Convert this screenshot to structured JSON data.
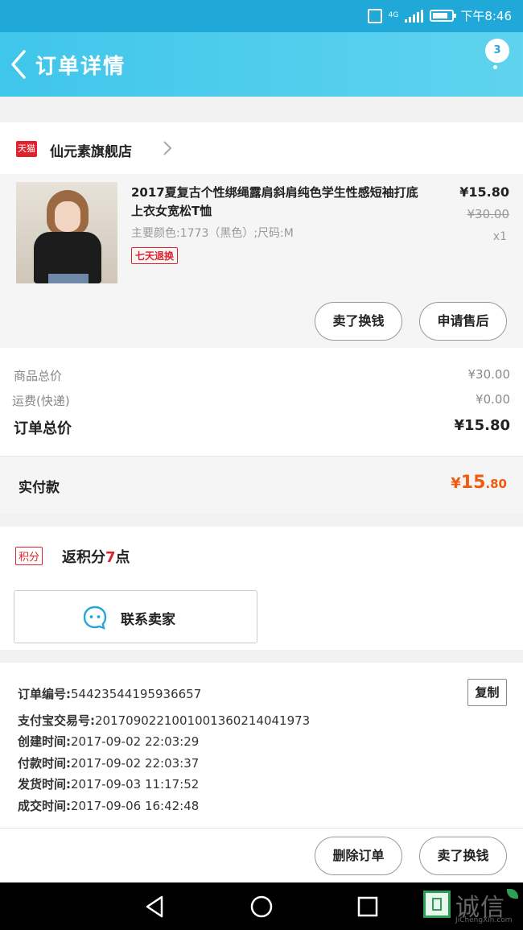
{
  "status_bar": {
    "network": "4G",
    "time": "下午8:46"
  },
  "header": {
    "title": "订单详情",
    "badge_count": "3"
  },
  "shop": {
    "tmall_label": "天猫",
    "name": "仙元素旗舰店"
  },
  "product": {
    "title": "2017夏复古个性绑绳露肩斜肩纯色学生性感短袖打底上衣女宽松T恤",
    "spec": "主要颜色:1773（黑色）;尺码:M",
    "tag": "七天退换",
    "price": "¥15.80",
    "original_price": "¥30.00",
    "quantity": "x1",
    "buttons": {
      "sell_back": "卖了换钱",
      "after_sale": "申请售后"
    }
  },
  "summary": {
    "goods_total_label": "商品总价",
    "goods_total_value": "¥30.00",
    "shipping_label": "运费(快递)",
    "shipping_value": "¥0.00",
    "order_total_label": "订单总价",
    "order_total_value": "¥15.80"
  },
  "payment": {
    "label": "实付款",
    "currency": "¥",
    "amount_int": "15",
    "amount_dec": ".80"
  },
  "points": {
    "tag": "积分",
    "prefix": "返积分",
    "count": "7",
    "suffix": "点",
    "contact_label": "联系卖家"
  },
  "order_info": {
    "order_no_label": "订单编号:",
    "order_no": "54423544195936657",
    "alipay_label": "支付宝交易号:",
    "alipay_no": "2017090221001001360214041973",
    "created_label": "创建时间:",
    "created": "2017-09-02 22:03:29",
    "paid_label": "付款时间:",
    "paid": "2017-09-02 22:03:37",
    "shipped_label": "发货时间:",
    "shipped": "2017-09-03 11:17:52",
    "completed_label": "成交时间:",
    "completed": "2017-09-06 16:42:48",
    "copy_label": "复制"
  },
  "actions": {
    "delete_order": "删除订单",
    "sell_back": "卖了换钱"
  },
  "watermark": {
    "cn": "诚信",
    "en": "JiChengXin.com"
  },
  "colors": {
    "header": "#3fc6ea",
    "accent_orange": "#f45a0e",
    "tmall_red": "#e0222c"
  }
}
